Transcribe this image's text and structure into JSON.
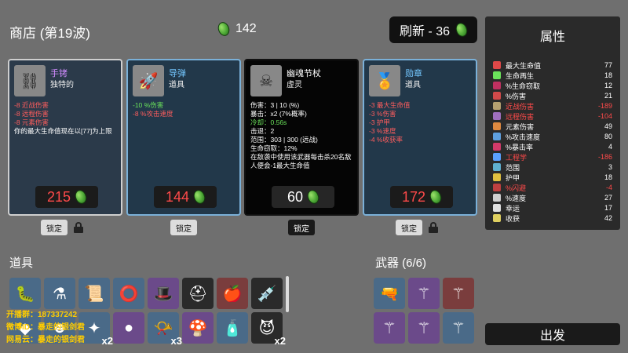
{
  "header": {
    "shop_title": "商店 (第19波)",
    "currency": "142",
    "reroll_label": "刷新 - 36"
  },
  "shop": {
    "cards": [
      {
        "name": "手铐",
        "type": "独特的",
        "stats": [
          "-8 近战伤害",
          "-8 远程伤害",
          "-8 元素伤害",
          "你的最大生命值现在以[77]为上限"
        ],
        "price": "215",
        "lock_label": "锁定"
      },
      {
        "name": "导弹",
        "type": "道具",
        "stats": [
          "-10 %伤害",
          "-8 %攻击速度"
        ],
        "price": "144",
        "lock_label": "锁定"
      },
      {
        "name": "幽魂节杖",
        "type": "虚灵",
        "stats": [
          "伤害：3 | 10 (%)",
          "暴击：x2 (7%概率)",
          "冷却：0.56s",
          "击退：2",
          "范围：303 | 300 (远战)",
          "生命窃取：12%",
          "在敌袭中使用该武器每击杀20名敌人便会-1最大生命值"
        ],
        "price": "60",
        "lock_label": "锁定"
      },
      {
        "name": "勋章",
        "type": "道具",
        "stats": [
          "-3 最大生命值",
          "-3 %伤害",
          "-3 护甲",
          "-3 %速度",
          "-4 %收获率"
        ],
        "price": "172",
        "lock_label": "锁定"
      }
    ]
  },
  "stats_panel": {
    "title": "属性",
    "rows": [
      {
        "label": "最大生命值",
        "value": "77",
        "color": "#ffffff"
      },
      {
        "label": "生命再生",
        "value": "18",
        "color": "#ffffff"
      },
      {
        "label": "%生命窃取",
        "value": "12",
        "color": "#ffffff"
      },
      {
        "label": "%伤害",
        "value": "21",
        "color": "#ffffff"
      },
      {
        "label": "近战伤害",
        "value": "-189",
        "color": "#ff4a4a"
      },
      {
        "label": "远程伤害",
        "value": "-104",
        "color": "#ff4a4a"
      },
      {
        "label": "元素伤害",
        "value": "49",
        "color": "#ffffff"
      },
      {
        "label": "%攻击速度",
        "value": "80",
        "color": "#ffffff"
      },
      {
        "label": "%暴击率",
        "value": "4",
        "color": "#ffffff"
      },
      {
        "label": "工程学",
        "value": "-186",
        "color": "#ff4a4a"
      },
      {
        "label": "范围",
        "value": "3",
        "color": "#ffffff"
      },
      {
        "label": "护甲",
        "value": "18",
        "color": "#ffffff"
      },
      {
        "label": "%闪避",
        "value": "-4",
        "color": "#ff4a4a"
      },
      {
        "label": "%速度",
        "value": "27",
        "color": "#ffffff"
      },
      {
        "label": "幸运",
        "value": "17",
        "color": "#ffffff"
      },
      {
        "label": "收获",
        "value": "42",
        "color": "#ffffff"
      }
    ]
  },
  "items": {
    "title": "道具",
    "counts": {
      "slot_13": "x2",
      "slot_10": "x3",
      "slot_16": "x2"
    }
  },
  "weapons": {
    "title": "武器 (6/6)"
  },
  "go_button_label": "出发",
  "overlay": {
    "line1": "开播群：187337242",
    "line2": "微博ID：暴走的银剑君",
    "line3": "网易云：暴走的银剑君"
  }
}
